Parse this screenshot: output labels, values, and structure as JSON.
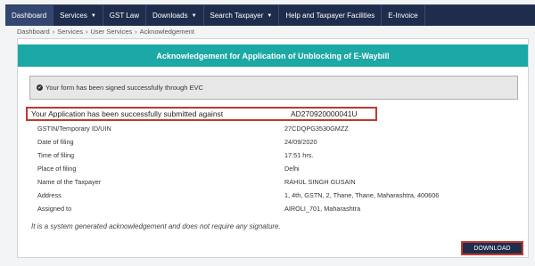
{
  "nav": {
    "items": [
      {
        "label": "Dashboard",
        "dropdown": false
      },
      {
        "label": "Services",
        "dropdown": true
      },
      {
        "label": "GST Law",
        "dropdown": false
      },
      {
        "label": "Downloads",
        "dropdown": true
      },
      {
        "label": "Search Taxpayer",
        "dropdown": true
      },
      {
        "label": "Help and Taxpayer Facilities",
        "dropdown": false
      },
      {
        "label": "E-Invoice",
        "dropdown": false
      }
    ]
  },
  "breadcrumb": [
    "Dashboard",
    "Services",
    "User Services",
    "Acknowledgement"
  ],
  "card": {
    "title": "Acknowledgement for Application of Unblocking of E-Waybill",
    "alert": "Your form has been signed successfully through EVC",
    "ack_label": "Your Application has been successfully submitted against",
    "ack_number": "AD270920000041U",
    "rows": [
      {
        "label": "GSTIN/Temporary ID/UIN",
        "value": "27CDQPG3530GMZZ"
      },
      {
        "label": "Date of filing",
        "value": "24/09/2020"
      },
      {
        "label": "Time of filing",
        "value": "17:51 hrs."
      },
      {
        "label": "Place of filing",
        "value": "Delhi"
      },
      {
        "label": "Name of the Taxpayer",
        "value": "RAHUL SINGH GUSAIN"
      },
      {
        "label": "Address",
        "value": "1, 4th, GSTN, 2, Thane, Thane, Maharashtra, 400606"
      },
      {
        "label": "Assigned to",
        "value": "AIROLI_701, Maharashtra"
      }
    ],
    "note": "It is a system generated acknowledgement and does not require any signature.",
    "download_label": "DOWNLOAD"
  },
  "colors": {
    "nav_bg": "#1f2d4d",
    "header_teal": "#1ca8a4",
    "highlight_red": "#c0392b"
  }
}
